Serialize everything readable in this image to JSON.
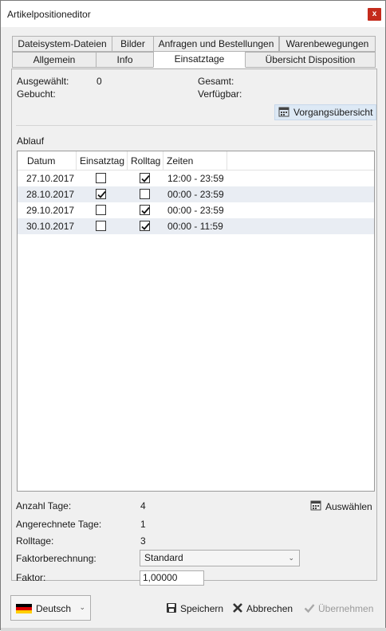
{
  "window": {
    "title": "Artikelpositioneditor",
    "close_label": "x"
  },
  "tabs_row1": [
    {
      "label": "Dateisystem-Dateien"
    },
    {
      "label": "Bilder"
    },
    {
      "label": "Anfragen und Bestellungen"
    },
    {
      "label": "Warenbewegungen"
    }
  ],
  "tabs_row2": [
    {
      "label": "Allgemein"
    },
    {
      "label": "Info"
    },
    {
      "label": "Einsatztage",
      "active": true
    },
    {
      "label": "Übersicht Disposition"
    }
  ],
  "summary": {
    "ausgewaehlt_label": "Ausgewählt:",
    "ausgewaehlt_value": "0",
    "gebucht_label": "Gebucht:",
    "gesamt_label": "Gesamt:",
    "verfuegbar_label": "Verfügbar:",
    "vorgang_button": "Vorgangsübersicht"
  },
  "ablauf": {
    "section_label": "Ablauf",
    "columns": [
      "Datum",
      "Einsatztag",
      "Rolltag",
      "Zeiten"
    ],
    "rows": [
      {
        "datum": "27.10.2017",
        "einsatztag": false,
        "rolltag": true,
        "zeiten": "12:00 - 23:59"
      },
      {
        "datum": "28.10.2017",
        "einsatztag": true,
        "rolltag": false,
        "zeiten": "00:00 - 23:59"
      },
      {
        "datum": "29.10.2017",
        "einsatztag": false,
        "rolltag": true,
        "zeiten": "00:00 - 23:59"
      },
      {
        "datum": "30.10.2017",
        "einsatztag": false,
        "rolltag": true,
        "zeiten": "00:00 - 11:59"
      }
    ]
  },
  "stats": {
    "anzahl_tage_label": "Anzahl Tage:",
    "anzahl_tage_value": "4",
    "angerechnete_label": "Angerechnete Tage:",
    "angerechnete_value": "1",
    "rolltage_label": "Rolltage:",
    "rolltage_value": "3",
    "auswaehlen_button": "Auswählen",
    "faktorberechnung_label": "Faktorberechnung:",
    "faktorberechnung_value": "Standard",
    "faktor_label": "Faktor:",
    "faktor_value": "1,00000"
  },
  "footer": {
    "language": "Deutsch",
    "save": "Speichern",
    "cancel": "Abbrechen",
    "apply": "Übernehmen"
  },
  "icons": {
    "calendar": "calendar-icon",
    "save": "floppy-disk-icon",
    "cancel": "x-icon",
    "apply": "checkmark-icon"
  }
}
